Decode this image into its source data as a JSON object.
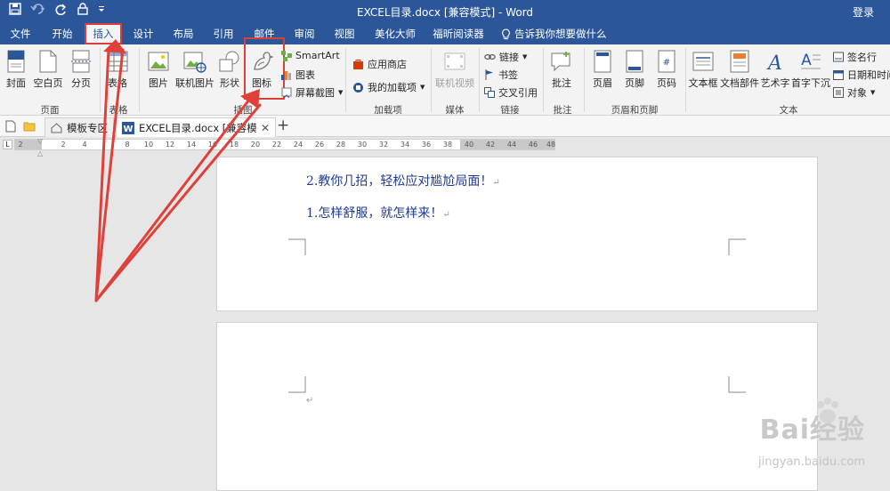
{
  "window": {
    "title": "EXCEL目录.docx [兼容模式] - Word",
    "login": "登录"
  },
  "tabs": [
    "文件",
    "开始",
    "插入",
    "设计",
    "布局",
    "引用",
    "邮件",
    "审阅",
    "视图",
    "美化大师",
    "福昕阅读器"
  ],
  "active_tab": "插入",
  "tell_me": "告诉我你想要做什么",
  "ribbon": {
    "pages": {
      "cover": "封面",
      "blank": "空白页",
      "break": "分页",
      "group": "页面"
    },
    "table": {
      "table": "表格",
      "group": "表格"
    },
    "illustrations": {
      "picture": "图片",
      "online_picture": "联机图片",
      "shapes": "形状",
      "icons": "图标",
      "smartart": "SmartArt",
      "chart": "图表",
      "screenshot": "屏幕截图",
      "group": "插图"
    },
    "addins": {
      "store": "应用商店",
      "my_addins": "我的加载项",
      "group": "加载项"
    },
    "media": {
      "online_video": "联机视频",
      "group": "媒体"
    },
    "links": {
      "link": "链接",
      "bookmark": "书签",
      "cross_ref": "交叉引用",
      "group": "链接"
    },
    "comments": {
      "comment": "批注",
      "group": "批注"
    },
    "header_footer": {
      "header": "页眉",
      "footer": "页脚",
      "page_number": "页码",
      "group": "页眉和页脚"
    },
    "text": {
      "textbox": "文本框",
      "quick_parts": "文档部件",
      "wordart": "艺术字",
      "dropcap": "首字下沉",
      "signature": "签名行",
      "datetime": "日期和时间",
      "object": "对象",
      "group": "文本"
    }
  },
  "doc_tabs": {
    "template": "模板专区",
    "document": "EXCEL目录.docx [兼容模式]",
    "add": "+"
  },
  "ruler_ticks": [
    "2",
    "2",
    "4",
    "8",
    "10",
    "12",
    "14",
    "16",
    "18",
    "20",
    "22",
    "24",
    "26",
    "28",
    "30",
    "32",
    "34",
    "36",
    "38",
    "40",
    "42",
    "44",
    "46",
    "48"
  ],
  "document": {
    "line1": "2.教你几招，轻松应对尴尬局面！",
    "line2": "1.怎样舒服，就怎样来！",
    "para_mark": "↵"
  },
  "watermark": {
    "brand": "Bai经验",
    "url": "jingyan.baidu.com"
  },
  "colors": {
    "title_bar": "#2b579a",
    "ribbon_bg": "#f3f3f3",
    "highlight": "#d9403a",
    "text_blue": "#1f3a93"
  }
}
